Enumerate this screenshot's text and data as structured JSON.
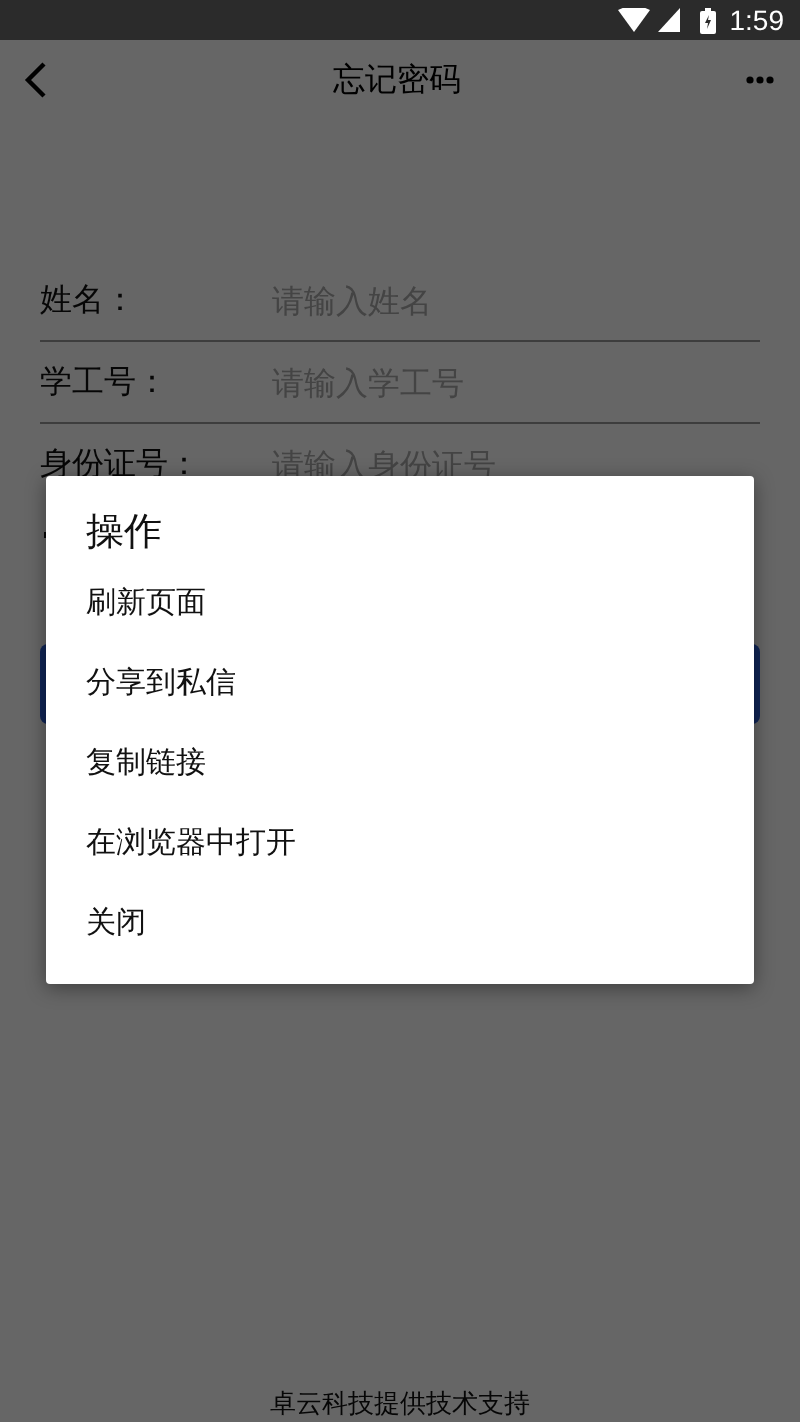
{
  "status_bar": {
    "time": "1:59"
  },
  "header": {
    "title": "忘记密码"
  },
  "form": {
    "fields": [
      {
        "label": "姓名：",
        "placeholder": "请输入姓名"
      },
      {
        "label": "学工号：",
        "placeholder": "请输入学工号"
      },
      {
        "label": "身份证号：",
        "placeholder": "请输入身份证号"
      }
    ]
  },
  "dialog": {
    "title": "操作",
    "items": [
      "刷新页面",
      "分享到私信",
      "复制链接",
      "在浏览器中打开",
      "关闭"
    ]
  },
  "footer": "卓云科技提供技术支持"
}
